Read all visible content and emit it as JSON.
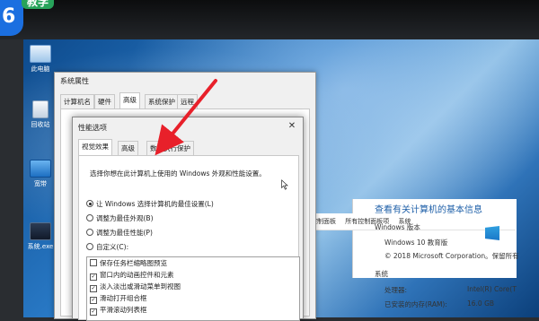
{
  "overlay": {
    "badge_number": "6",
    "badge_text": "教学"
  },
  "desktop": {
    "icons": [
      {
        "name": "此电脑",
        "icon": "computer-icon"
      },
      {
        "name": "回收站",
        "icon": "recycle-bin-icon"
      },
      {
        "name": "宽带",
        "icon": "broadband-icon"
      },
      {
        "name": "系统.exe",
        "icon": "exe-icon"
      }
    ]
  },
  "system_window": {
    "address_parts": [
      "控制面板",
      "所有控制面板项",
      "系统"
    ],
    "heading": "查看有关计算机的基本信息",
    "edition_label": "Windows 版本",
    "edition": "Windows 10 教育版",
    "copyright": "© 2018 Microsoft Corporation。保留所有",
    "system_label": "系统",
    "processor_label": "处理器:",
    "processor_value": "Intel(R) Core(T",
    "ram_label": "已安装的内存(RAM):",
    "ram_value": "16.0 GB"
  },
  "sys_props": {
    "title": "系统属性",
    "tabs": [
      "计算机名",
      "硬件",
      "高级",
      "系统保护",
      "远程"
    ],
    "active_tab": "高级"
  },
  "perf_options": {
    "title": "性能选项",
    "close": "✕",
    "tabs": [
      "视觉效果",
      "高级",
      "数据执行保护"
    ],
    "active_tab": "视觉效果",
    "description": "选择你想在此计算机上使用的 Windows 外观和性能设置。",
    "radios": [
      {
        "label": "让 Windows 选择计算机的最佳设置(L)",
        "checked": true
      },
      {
        "label": "调整为最佳外观(B)",
        "checked": false
      },
      {
        "label": "调整为最佳性能(P)",
        "checked": false
      },
      {
        "label": "自定义(C):",
        "checked": false
      }
    ],
    "checkboxes": [
      {
        "label": "保存任务栏缩略图预览",
        "checked": false
      },
      {
        "label": "窗口内的动画控件和元素",
        "checked": true
      },
      {
        "label": "淡入淡出或滑动菜单到视图",
        "checked": true
      },
      {
        "label": "滑动打开组合框",
        "checked": true
      },
      {
        "label": "平滑滚动列表框",
        "checked": true
      }
    ]
  },
  "colors": {
    "accent_arrow": "#e8202a",
    "heading_blue": "#1e5fa8"
  }
}
